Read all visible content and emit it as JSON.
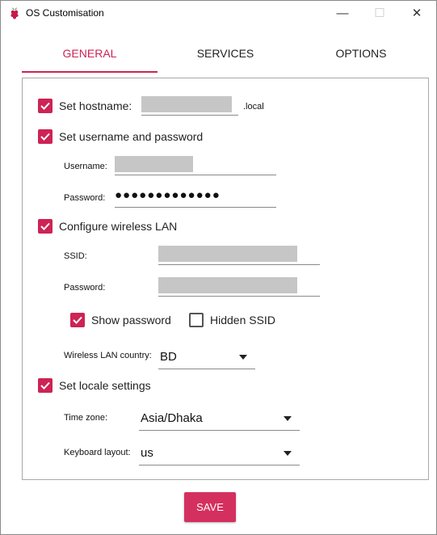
{
  "window": {
    "title": "OS Customisation",
    "minimize_glyph": "—",
    "maximize_glyph": "☐",
    "close_glyph": "✕",
    "app_icon": "raspberry-icon"
  },
  "tabs": [
    {
      "label": "GENERAL",
      "active": true
    },
    {
      "label": "SERVICES",
      "active": false
    },
    {
      "label": "OPTIONS",
      "active": false
    }
  ],
  "general": {
    "hostname": {
      "label": "Set hostname:",
      "checked": true,
      "value": "",
      "suffix": ".local"
    },
    "user": {
      "label": "Set username and password",
      "checked": true,
      "username_label": "Username:",
      "username_value": "",
      "password_label": "Password:",
      "password_value": "●●●●●●●●●●●●●"
    },
    "wlan": {
      "label": "Configure wireless LAN",
      "checked": true,
      "ssid_label": "SSID:",
      "ssid_value": "",
      "password_label": "Password:",
      "password_value": "",
      "show_password_label": "Show password",
      "show_password_checked": true,
      "hidden_ssid_label": "Hidden SSID",
      "hidden_ssid_checked": false,
      "country_label": "Wireless LAN country:",
      "country_value": "BD"
    },
    "locale": {
      "label": "Set locale settings",
      "checked": true,
      "timezone_label": "Time zone:",
      "timezone_value": "Asia/Dhaka",
      "keyboard_label": "Keyboard layout:",
      "keyboard_value": "us"
    }
  },
  "save_label": "SAVE",
  "colors": {
    "accent": "#cd2355",
    "save": "#d4305f",
    "redacted": "#c6c6c6"
  }
}
